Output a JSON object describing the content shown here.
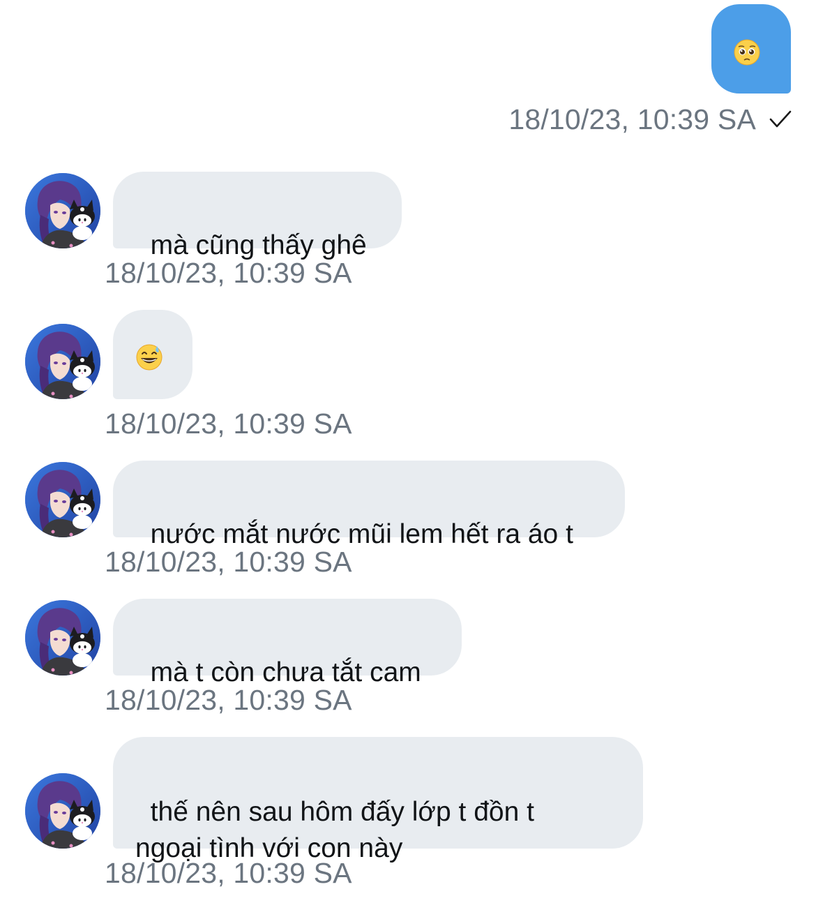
{
  "conversation": {
    "sent": [
      {
        "emoji": "pleading-face",
        "timestamp": "18/10/23, 10:39 SA",
        "status": "sent"
      }
    ],
    "received": [
      {
        "text": "mà cũng thấy ghê",
        "timestamp": "18/10/23, 10:39 SA"
      },
      {
        "emoji": "grinning-face-with-sweat",
        "timestamp": "18/10/23, 10:39 SA"
      },
      {
        "text": "nước mắt nước mũi lem hết ra áo t",
        "timestamp": "18/10/23, 10:39 SA"
      },
      {
        "text": "mà t còn chưa tắt cam",
        "timestamp": "18/10/23, 10:39 SA"
      },
      {
        "text": "thế nên sau hôm đấy lớp t đồn t\nngoại tình với con này",
        "timestamp": "18/10/23, 10:39 SA"
      }
    ]
  },
  "colors": {
    "sent_bubble": "#4c9ee8",
    "received_bubble": "#e8ecf0",
    "timestamp": "#6b7580",
    "text": "#111417"
  }
}
